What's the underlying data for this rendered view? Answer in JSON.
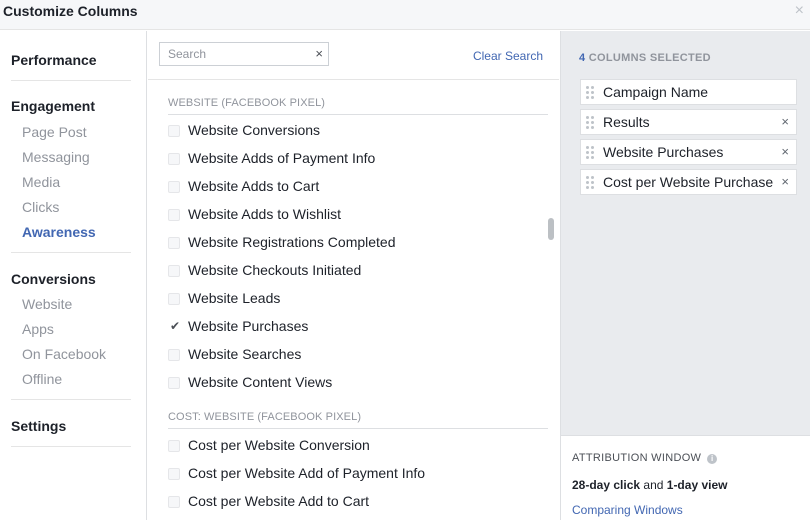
{
  "dialog": {
    "title": "Customize Columns",
    "close_symbol": "×"
  },
  "sidebar": {
    "groups": [
      {
        "heading": "Performance",
        "items": []
      },
      {
        "heading": "Engagement",
        "items": [
          "Page Post",
          "Messaging",
          "Media",
          "Clicks",
          "Awareness"
        ]
      },
      {
        "heading": "Conversions",
        "items": [
          "Website",
          "Apps",
          "On Facebook",
          "Offline"
        ]
      },
      {
        "heading": "Settings",
        "items": []
      }
    ],
    "active_item": "Awareness"
  },
  "search": {
    "placeholder": "Search",
    "value": "",
    "clear_symbol": "×",
    "clear_label": "Clear Search"
  },
  "sections": [
    {
      "label": "WEBSITE (FACEBOOK PIXEL)",
      "items": [
        {
          "label": "Website Conversions",
          "checked": false
        },
        {
          "label": "Website Adds of Payment Info",
          "checked": false
        },
        {
          "label": "Website Adds to Cart",
          "checked": false
        },
        {
          "label": "Website Adds to Wishlist",
          "checked": false
        },
        {
          "label": "Website Registrations Completed",
          "checked": false
        },
        {
          "label": "Website Checkouts Initiated",
          "checked": false
        },
        {
          "label": "Website Leads",
          "checked": false
        },
        {
          "label": "Website Purchases",
          "checked": true
        },
        {
          "label": "Website Searches",
          "checked": false
        },
        {
          "label": "Website Content Views",
          "checked": false
        }
      ]
    },
    {
      "label": "COST: WEBSITE (FACEBOOK PIXEL)",
      "items": [
        {
          "label": "Cost per Website Conversion",
          "checked": false
        },
        {
          "label": "Cost per Website Add of Payment Info",
          "checked": false
        },
        {
          "label": "Cost per Website Add to Cart",
          "checked": false
        }
      ]
    }
  ],
  "selected": {
    "count": "4",
    "label": "COLUMNS SELECTED",
    "columns": [
      {
        "label": "Campaign Name",
        "removable": false
      },
      {
        "label": "Results",
        "removable": true
      },
      {
        "label": "Website Purchases",
        "removable": true
      },
      {
        "label": "Cost per Website Purchase",
        "removable": true
      }
    ],
    "remove_symbol": "×"
  },
  "attribution": {
    "title": "ATTRIBUTION WINDOW",
    "info_symbol": "i",
    "click_window": "28-day click",
    "joiner": "and",
    "view_window": "1-day view",
    "link": "Comparing Windows"
  },
  "colors": {
    "accent": "#4267b2",
    "muted": "#90949c",
    "panel_bg": "#e9ebee"
  },
  "icons": {
    "close": "close-icon",
    "clear": "clear-search-icon",
    "check": "checkmark-icon",
    "drag": "drag-handle-icon",
    "info": "info-icon",
    "remove": "remove-column-icon"
  }
}
